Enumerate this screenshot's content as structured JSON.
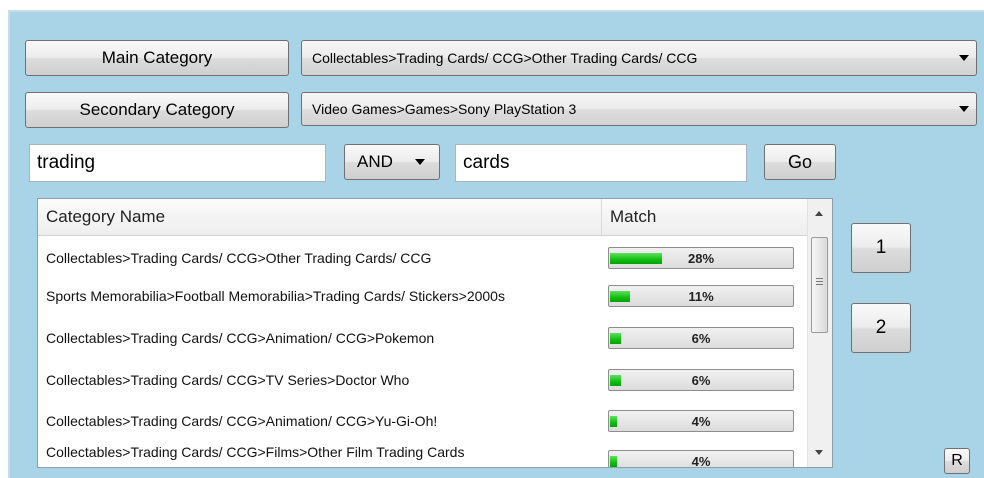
{
  "main_category": {
    "button_label": "Main Category",
    "selected": "Collectables>Trading Cards/ CCG>Other Trading Cards/ CCG"
  },
  "secondary_category": {
    "button_label": "Secondary Category",
    "selected": "Video Games>Games>Sony PlayStation 3"
  },
  "search": {
    "term1": "trading",
    "operator": "AND",
    "term2": "cards",
    "go_label": "Go"
  },
  "grid": {
    "columns": [
      "Category Name",
      "Match"
    ],
    "rows": [
      {
        "name": "Collectables>Trading Cards/ CCG>Other Trading Cards/ CCG",
        "match": "28%",
        "level": 0.28
      },
      {
        "name": "Sports Memorabilia>Football Memorabilia>Trading Cards/ Stickers>2000s",
        "match": "11%",
        "level": 0.11
      },
      {
        "name": "Collectables>Trading Cards/ CCG>Animation/ CCG>Pokemon",
        "match": "6%",
        "level": 0.06
      },
      {
        "name": "Collectables>Trading Cards/ CCG>TV Series>Doctor Who",
        "match": "6%",
        "level": 0.06
      },
      {
        "name": "Collectables>Trading Cards/ CCG>Animation/ CCG>Yu-Gi-Oh!",
        "match": "4%",
        "level": 0.04
      },
      {
        "name": "Collectables>Trading Cards/ CCG>Films>Other Film Trading Cards",
        "match": "4%",
        "level": 0.04
      }
    ]
  },
  "side_buttons": {
    "one": "1",
    "two": "2",
    "reset": "R"
  },
  "colors": {
    "panel_background": "#a9d3e6",
    "progress_fill": "#0fbf0f"
  }
}
